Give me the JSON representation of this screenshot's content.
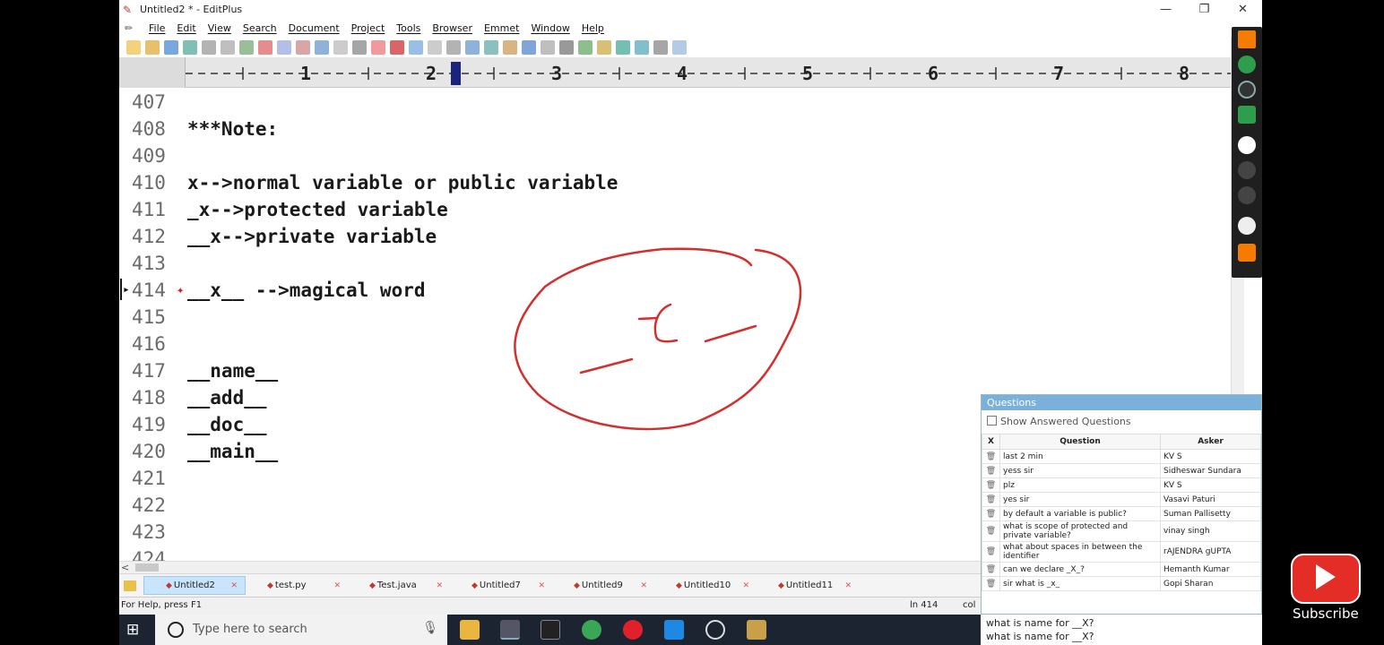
{
  "window": {
    "title": "Untitled2 * - EditPlus",
    "app_icon": "editplus-icon",
    "controls": [
      "—",
      "❐",
      "✕"
    ]
  },
  "menubar": {
    "items": [
      "File",
      "Edit",
      "View",
      "Search",
      "Document",
      "Project",
      "Tools",
      "Browser",
      "Emmet",
      "Window",
      "Help"
    ]
  },
  "ruler": {
    "labels": [
      "1",
      "2",
      "3",
      "4",
      "5",
      "6",
      "7",
      "8"
    ]
  },
  "editor": {
    "lines": [
      {
        "num": "407",
        "code": ""
      },
      {
        "num": "408",
        "code": "***Note:"
      },
      {
        "num": "409",
        "code": ""
      },
      {
        "num": "410",
        "code": "x-->normal variable or public variable"
      },
      {
        "num": "411",
        "code": "_x-->protected variable"
      },
      {
        "num": "412",
        "code": "__x-->private variable"
      },
      {
        "num": "413",
        "code": ""
      },
      {
        "num": "414",
        "code": "__x__ -->magical word"
      },
      {
        "num": "415",
        "code": ""
      },
      {
        "num": "416",
        "code": ""
      },
      {
        "num": "417",
        "code": "__name__"
      },
      {
        "num": "418",
        "code": "__add__"
      },
      {
        "num": "419",
        "code": "__doc__"
      },
      {
        "num": "420",
        "code": "__main__"
      },
      {
        "num": "421",
        "code": ""
      },
      {
        "num": "422",
        "code": ""
      },
      {
        "num": "423",
        "code": ""
      },
      {
        "num": "424",
        "code": ""
      }
    ]
  },
  "tabs": [
    {
      "label": "Untitled2",
      "active": true
    },
    {
      "label": "test.py",
      "active": false
    },
    {
      "label": "Test.java",
      "active": false
    },
    {
      "label": "Untitled7",
      "active": false
    },
    {
      "label": "Untitled9",
      "active": false
    },
    {
      "label": "Untitled10",
      "active": false
    },
    {
      "label": "Untitled11",
      "active": false
    }
  ],
  "statusbar": {
    "help": "For Help, press F1",
    "line": "ln 414",
    "col": "col"
  },
  "taskbar": {
    "search_placeholder": "Type here to search"
  },
  "questions": {
    "title": "Questions",
    "show_answered": "Show Answered Questions",
    "headers": {
      "x": "X",
      "question": "Question",
      "asker": "Asker"
    },
    "rows": [
      {
        "question": "last 2 min",
        "asker": "KV S"
      },
      {
        "question": "yess sir",
        "asker": "Sidheswar Sundara"
      },
      {
        "question": "plz",
        "asker": "KV S"
      },
      {
        "question": "yes sir",
        "asker": "Vasavi Paturi"
      },
      {
        "question": "by default a variable is public?",
        "asker": "Suman Pallisetty"
      },
      {
        "question": "what is scope of protected and private variable?",
        "asker": "vinay singh"
      },
      {
        "question": "what about spaces in between the identifier",
        "asker": "rAJENDRA gUPTA"
      },
      {
        "question": "can we declare _X_?",
        "asker": "Hemanth Kumar"
      },
      {
        "question": "sir what is _x_",
        "asker": "Gopi Sharan"
      }
    ],
    "input_lines": [
      "what is name for __X?",
      "what is name for __X?"
    ]
  },
  "subscribe": {
    "label": "Subscribe"
  },
  "colors": {
    "ink": "#d32f2f",
    "active_tab": "#c9e5fb",
    "questions_header": "#7ab0da"
  }
}
